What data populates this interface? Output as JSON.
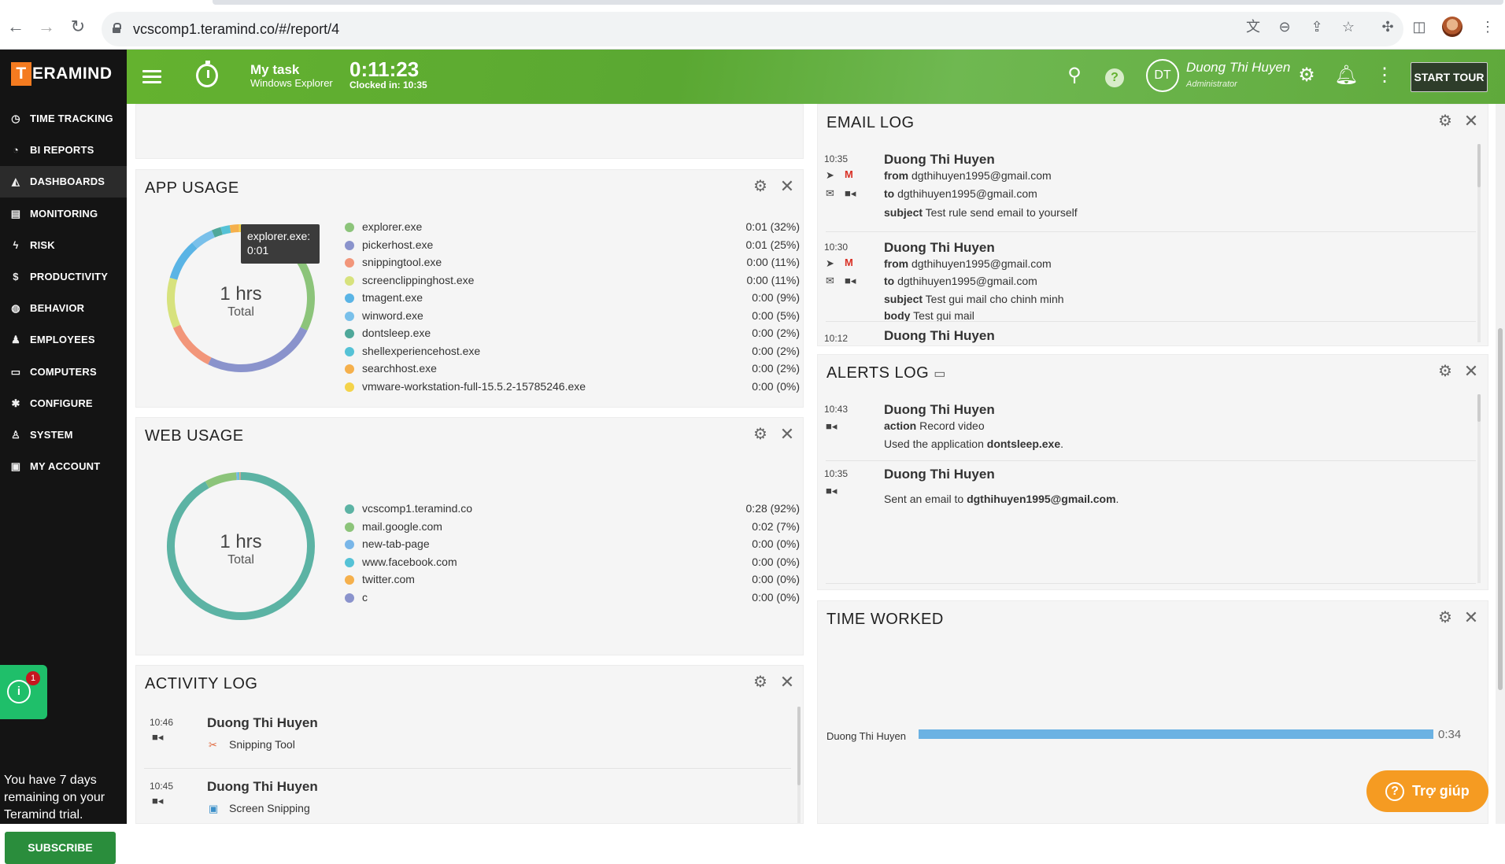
{
  "browser": {
    "url": "vcscomp1.teramind.co/#/report/4",
    "icons": [
      "back-icon",
      "forward-icon",
      "reload-icon",
      "translate-icon",
      "zoom-icon",
      "share-icon",
      "star-icon",
      "extensions-icon",
      "sidepanel-icon",
      "profile-avatar"
    ]
  },
  "brand": {
    "logo_letter": "T",
    "logo_rest": "ERAMIND",
    "accent": "#f47b20",
    "green": "#5aa832"
  },
  "sidebar": {
    "items": [
      {
        "label": "TIME TRACKING",
        "icon": "clock-icon",
        "glyph": "◷"
      },
      {
        "label": "BI REPORTS",
        "icon": "pie-chart-icon",
        "glyph": "◔"
      },
      {
        "label": "DASHBOARDS",
        "icon": "dashboard-icon",
        "glyph": "◭",
        "active": true
      },
      {
        "label": "MONITORING",
        "icon": "monitoring-icon",
        "glyph": "▤"
      },
      {
        "label": "RISK",
        "icon": "bolt-icon",
        "glyph": "ϟ"
      },
      {
        "label": "PRODUCTIVITY",
        "icon": "dollar-icon",
        "glyph": "$"
      },
      {
        "label": "BEHAVIOR",
        "icon": "gamepad-icon",
        "glyph": "◍"
      },
      {
        "label": "EMPLOYEES",
        "icon": "users-icon",
        "glyph": "♟"
      },
      {
        "label": "COMPUTERS",
        "icon": "monitor-icon",
        "glyph": "▭"
      },
      {
        "label": "CONFIGURE",
        "icon": "cog-icon",
        "glyph": "✱"
      },
      {
        "label": "SYSTEM",
        "icon": "user-cog-icon",
        "glyph": "♙"
      },
      {
        "label": "MY ACCOUNT",
        "icon": "account-icon",
        "glyph": "▣"
      }
    ],
    "notification_count": "1",
    "trial_text": "You have 7 days remaining on your Teramind trial.",
    "subscribe_label": "SUBSCRIBE"
  },
  "topbar": {
    "task_title": "My task",
    "task_sub": "Windows Explorer",
    "clock": "0:11:23",
    "clocked_in": "Clocked in: 10:35",
    "user_initials": "DT",
    "user_name": "Duong Thi Huyen",
    "user_role": "Administrator",
    "start_tour": "START TOUR"
  },
  "app_usage": {
    "title": "APP USAGE",
    "total": "1 hrs",
    "total_label": "Total",
    "tooltip_line1": "explorer.exe:",
    "tooltip_line2": "0:01",
    "items": [
      {
        "name": "explorer.exe",
        "value": "0:01 (32%)",
        "pct": 32,
        "color": "#8cc47a"
      },
      {
        "name": "pickerhost.exe",
        "value": "0:01 (25%)",
        "pct": 25,
        "color": "#8a93cc"
      },
      {
        "name": "snippingtool.exe",
        "value": "0:00 (11%)",
        "pct": 11,
        "color": "#f2967a"
      },
      {
        "name": "screenclippinghost.exe",
        "value": "0:00 (11%)",
        "pct": 11,
        "color": "#d7e27d"
      },
      {
        "name": "tmagent.exe",
        "value": "0:00 (9%)",
        "pct": 9,
        "color": "#5ab4e5"
      },
      {
        "name": "winword.exe",
        "value": "0:00 (5%)",
        "pct": 5,
        "color": "#79c0ea"
      },
      {
        "name": "dontsleep.exe",
        "value": "0:00 (2%)",
        "pct": 2,
        "color": "#4fa89a"
      },
      {
        "name": "shellexperiencehost.exe",
        "value": "0:00 (2%)",
        "pct": 2,
        "color": "#55c2d6"
      },
      {
        "name": "searchhost.exe",
        "value": "0:00 (2%)",
        "pct": 2,
        "color": "#f5b04c"
      },
      {
        "name": "vmware-workstation-full-15.5.2-15785246.exe",
        "value": "0:00 (0%)",
        "pct": 0.4,
        "color": "#f4d34a"
      }
    ]
  },
  "web_usage": {
    "title": "WEB USAGE",
    "total": "1 hrs",
    "total_label": "Total",
    "items": [
      {
        "name": "vcscomp1.teramind.co",
        "value": "0:28 (92%)",
        "pct": 92,
        "color": "#5cb3a4"
      },
      {
        "name": "mail.google.com",
        "value": "0:02 (7%)",
        "pct": 7,
        "color": "#8cc47a"
      },
      {
        "name": "new-tab-page",
        "value": "0:00 (0%)",
        "pct": 0.4,
        "color": "#79b6e8"
      },
      {
        "name": "www.facebook.com",
        "value": "0:00 (0%)",
        "pct": 0.3,
        "color": "#55c2d6"
      },
      {
        "name": "twitter.com",
        "value": "0:00 (0%)",
        "pct": 0.2,
        "color": "#f5b04c"
      },
      {
        "name": "c",
        "value": "0:00 (0%)",
        "pct": 0.1,
        "color": "#8a93cc"
      }
    ]
  },
  "activity_log": {
    "title": "ACTIVITY LOG",
    "entries": [
      {
        "time": "10:46",
        "name": "Duong Thi Huyen",
        "app": "Snipping Tool"
      },
      {
        "time": "10:45",
        "name": "Duong Thi Huyen",
        "app": "Screen Snipping"
      }
    ]
  },
  "email_log": {
    "title": "EMAIL LOG",
    "entries": [
      {
        "time": "10:35",
        "name": "Duong Thi Huyen",
        "from_label": "from",
        "from": "dgthihuyen1995@gmail.com",
        "to_label": "to",
        "to": "dgthihuyen1995@gmail.com",
        "subject_label": "subject",
        "subject": "Test rule send email to yourself"
      },
      {
        "time": "10:30",
        "name": "Duong Thi Huyen",
        "from_label": "from",
        "from": "dgthihuyen1995@gmail.com",
        "to_label": "to",
        "to": "dgthihuyen1995@gmail.com",
        "subject_label": "subject",
        "subject": "Test gui mail cho chinh minh",
        "body_label": "body",
        "body": "Test gui mail"
      },
      {
        "time": "10:12",
        "name": "Duong Thi Huyen"
      }
    ]
  },
  "alerts_log": {
    "title": "ALERTS LOG",
    "entries": [
      {
        "time": "10:43",
        "name": "Duong Thi Huyen",
        "action_label": "action",
        "action": "Record video",
        "desc_prefix": "Used the application",
        "desc_bold": "dontsleep.exe",
        "desc_suffix": "."
      },
      {
        "time": "10:35",
        "name": "Duong Thi Huyen",
        "desc_prefix": "Sent an email to",
        "desc_bold": "dgthihuyen1995@gmail.com",
        "desc_suffix": "."
      }
    ]
  },
  "time_worked": {
    "title": "TIME WORKED",
    "chart_data": {
      "type": "bar",
      "categories": [
        "Duong Thi Huyen"
      ],
      "values": [
        34
      ],
      "value_labels": [
        "0:34"
      ]
    }
  },
  "help_button": "Trợ giúp"
}
